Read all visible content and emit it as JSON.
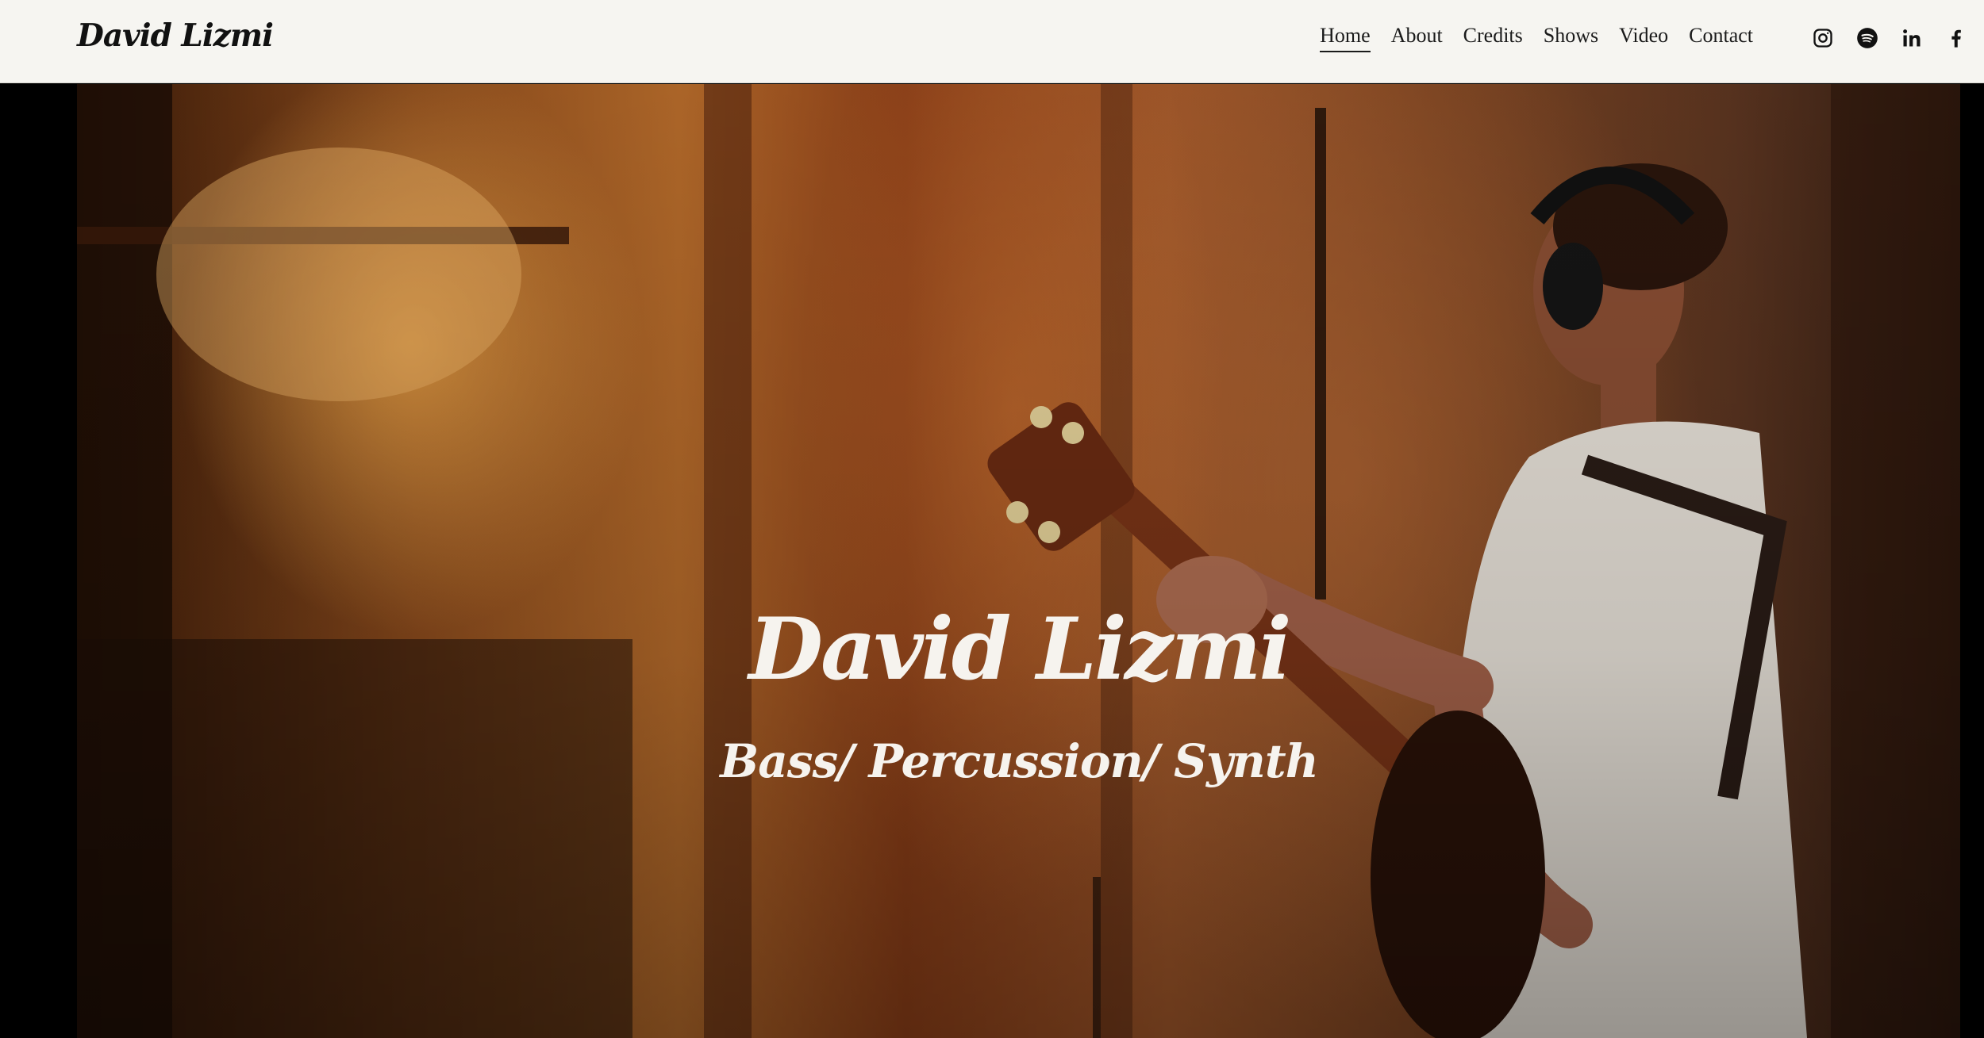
{
  "header": {
    "logo": "David Lizmi",
    "nav": [
      {
        "label": "Home",
        "active": true
      },
      {
        "label": "About"
      },
      {
        "label": "Credits"
      },
      {
        "label": "Shows"
      },
      {
        "label": "Video"
      },
      {
        "label": "Contact"
      }
    ],
    "socials": [
      "instagram-icon",
      "spotify-icon",
      "linkedin-icon",
      "facebook-icon"
    ]
  },
  "hero": {
    "title": "David Lizmi",
    "subtitle": "Bass/ Percussion/ Synth",
    "image": "musician-with-guitar-and-headphones-in-studio"
  },
  "colors": {
    "header_bg": "#f6f5f1",
    "text_dark": "#1a1a1a",
    "hero_text": "#f6f3ee"
  }
}
